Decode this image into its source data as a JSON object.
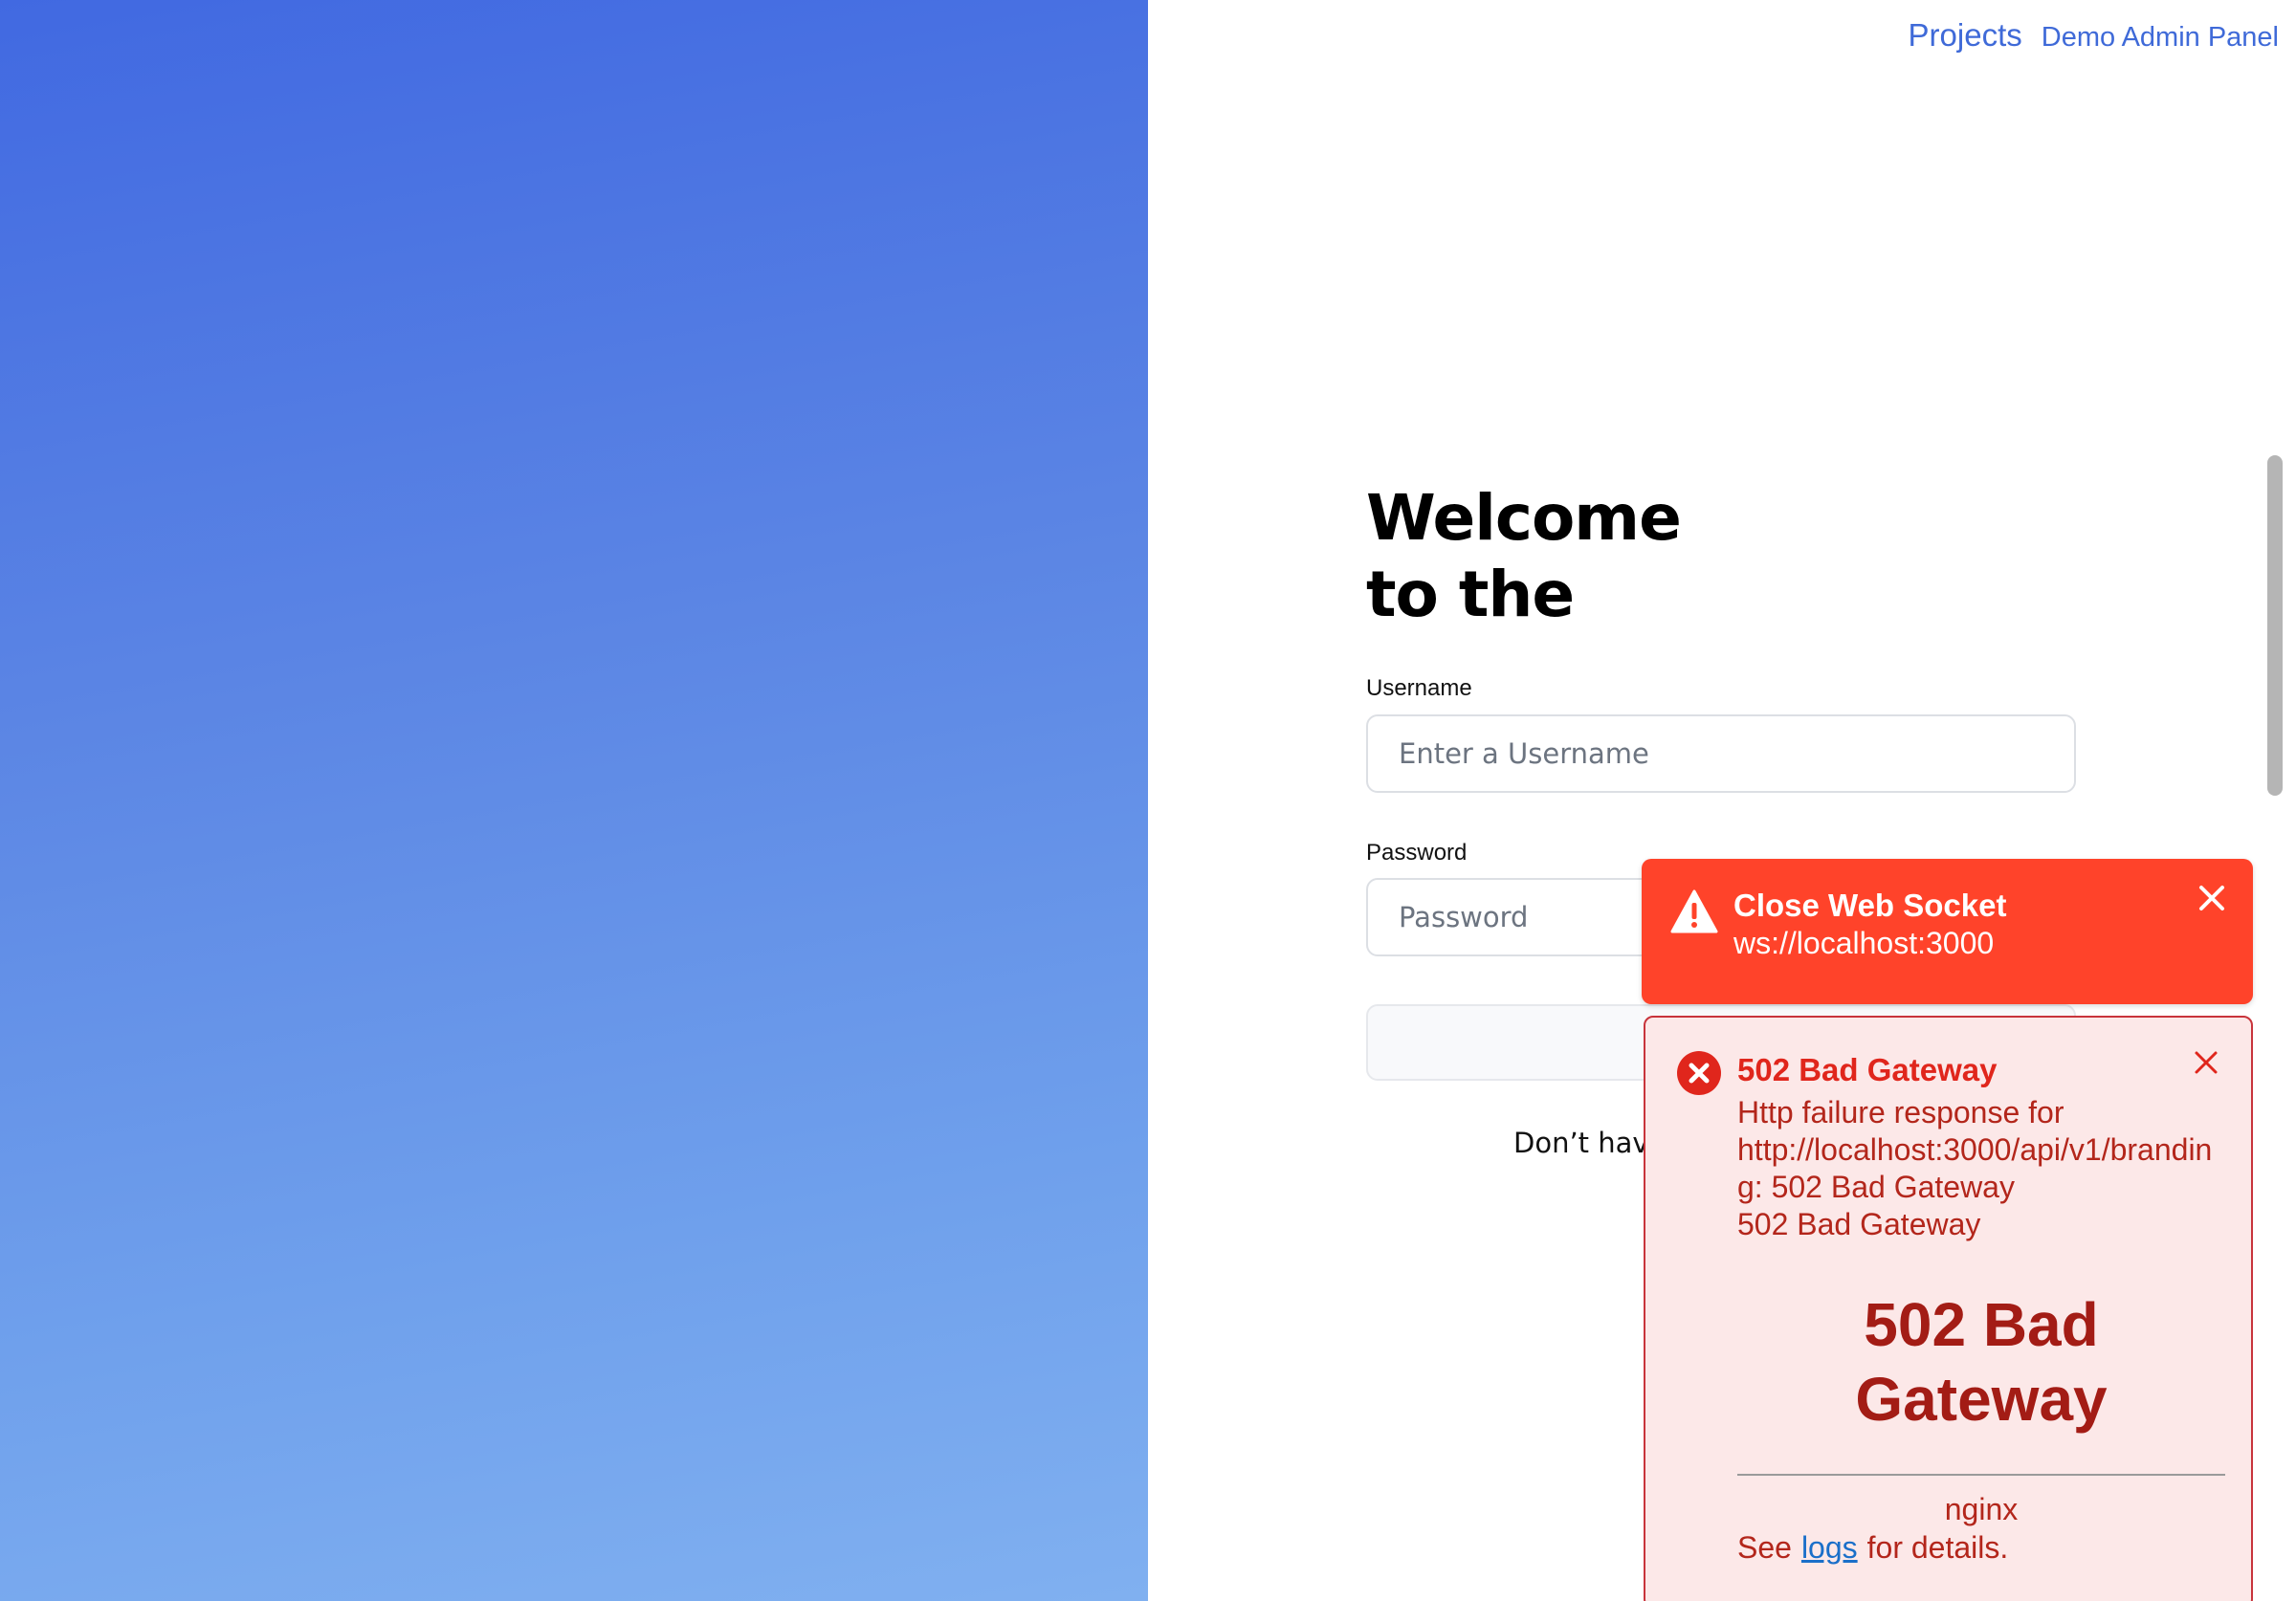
{
  "nav": {
    "projects_label": "Projects",
    "admin_label": "Demo Admin Panel"
  },
  "login": {
    "welcome_line1": "Welcome",
    "welcome_line2": "to the",
    "username_label": "Username",
    "username_placeholder": "Enter a Username",
    "password_label": "Password",
    "password_placeholder": "Password",
    "signup_prompt": "Don’t have"
  },
  "toasts": {
    "warning": {
      "title": "Close Web Socket",
      "message": "ws://localhost:3000",
      "icon": "warning-icon",
      "color": "#ff432a"
    },
    "error": {
      "title": "502 Bad Gateway",
      "line1": "Http failure response for",
      "line2": "http://localhost:3000/api/v1/branding: 502 Bad Gateway",
      "line3": "502 Bad Gateway",
      "heading": "502 Bad Gateway",
      "server": "nginx",
      "details_prefix": "See",
      "details_link": "logs",
      "details_suffix": "for details.",
      "icon": "error-icon",
      "color": "#e0261c"
    }
  },
  "colors": {
    "gradient_top": "#4169e1",
    "gradient_bottom": "#80b0f0",
    "link": "#3f6ad8"
  }
}
